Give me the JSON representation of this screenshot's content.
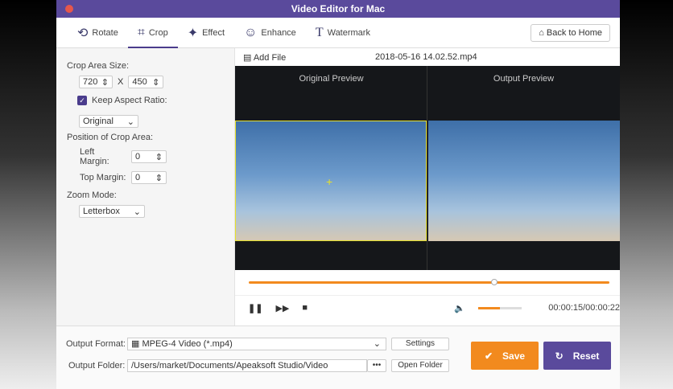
{
  "window": {
    "title": "Video Editor for Mac"
  },
  "toolbar": {
    "tabs": [
      {
        "label": "Rotate",
        "icon": "rotate-icon"
      },
      {
        "label": "Crop",
        "icon": "crop-icon"
      },
      {
        "label": "Effect",
        "icon": "sparkle-icon"
      },
      {
        "label": "Enhance",
        "icon": "palette-icon"
      },
      {
        "label": "Watermark",
        "icon": "text-icon"
      }
    ],
    "active": "Crop",
    "back_home": "Back to Home"
  },
  "crop": {
    "size_label": "Crop Area Size:",
    "width": "720",
    "x": "X",
    "height": "450",
    "keep_aspect_label": "Keep Aspect Ratio:",
    "keep_aspect_checked": true,
    "aspect_value": "Original",
    "position_label": "Position of Crop Area:",
    "left_margin_label": "Left Margin:",
    "left_margin": "0",
    "top_margin_label": "Top Margin:",
    "top_margin": "0",
    "zoom_label": "Zoom Mode:",
    "zoom_value": "Letterbox"
  },
  "file": {
    "add_file": "Add File",
    "filename": "2018-05-16 14.02.52.mp4"
  },
  "preview": {
    "original": "Original Preview",
    "output": "Output Preview"
  },
  "player": {
    "progress": 0.68,
    "volume": 0.5,
    "time": "00:00:15/00:00:22",
    "accent": "#f28a1e"
  },
  "output": {
    "format_label": "Output Format:",
    "format_value": "MPEG-4 Video (*.mp4)",
    "settings": "Settings",
    "folder_label": "Output Folder:",
    "folder_value": "/Users/market/Documents/Apeaksoft Studio/Video",
    "browse": "•••",
    "open_folder": "Open Folder",
    "save": "Save",
    "reset": "Reset",
    "save_color": "#f28a1e",
    "reset_color": "#5a4a9c"
  }
}
